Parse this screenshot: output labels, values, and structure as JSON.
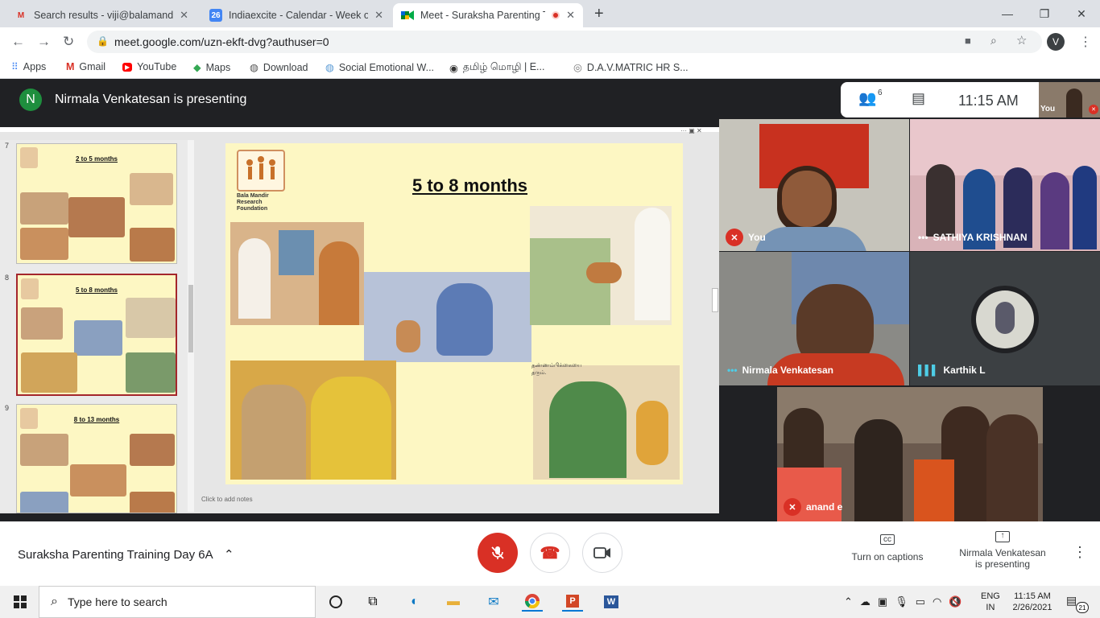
{
  "browser": {
    "tabs": [
      {
        "title": "Search results - viji@balamandir.",
        "icon": "gmail-icon"
      },
      {
        "title": "Indiaexcite - Calendar - Week of",
        "icon": "calendar-icon",
        "badge": "26"
      },
      {
        "title": "Meet - Suraksha Parenting T",
        "icon": "meet-icon"
      }
    ],
    "url": "meet.google.com/uzn-ekft-dvg?authuser=0",
    "profile_initial": "V",
    "bookmarks": [
      "Apps",
      "Gmail",
      "YouTube",
      "Maps",
      "Download",
      "Social Emotional W...",
      "தமிழ் மொழி | E...",
      "D.A.V.MATRIC HR S..."
    ]
  },
  "meet": {
    "presenter_initial": "N",
    "presenting_text": "Nirmala Venkatesan is presenting",
    "participant_count": "6",
    "time": "11:15  AM",
    "self_label": "You",
    "meeting_name": "Suraksha Parenting Training Day 6A",
    "captions_label": "Turn on captions",
    "presenting_label_line1": "Nirmala Venkatesan",
    "presenting_label_line2": "is presenting",
    "participants": [
      {
        "name": "You",
        "muted": true
      },
      {
        "name": "SATHIYA KRISHNAN",
        "muted": false
      },
      {
        "name": "Nirmala Venkatesan",
        "muted": false
      },
      {
        "name": "Karthik L",
        "muted": false
      },
      {
        "name": "anand e",
        "muted": true
      }
    ]
  },
  "presentation": {
    "thumbnails": [
      {
        "number": "7",
        "title": "2 to 5 months"
      },
      {
        "number": "8",
        "title": "5 to 8 months"
      },
      {
        "number": "9",
        "title": "8 to 13 months"
      }
    ],
    "slide_title": "5 to 8 months",
    "logo_text": "Bala Mandir Research Foundation",
    "notes_placeholder": "Click to add notes"
  },
  "taskbar": {
    "search_placeholder": "Type here to search",
    "lang_line1": "ENG",
    "lang_line2": "IN",
    "clock_time": "11:15 AM",
    "clock_date": "2/26/2021",
    "notification_count": "21"
  },
  "colors": {
    "meet_bg": "#202124",
    "hangup_red": "#d93025",
    "slide_bg": "#fdf7c3",
    "thumb_selected": "#a4262c"
  }
}
